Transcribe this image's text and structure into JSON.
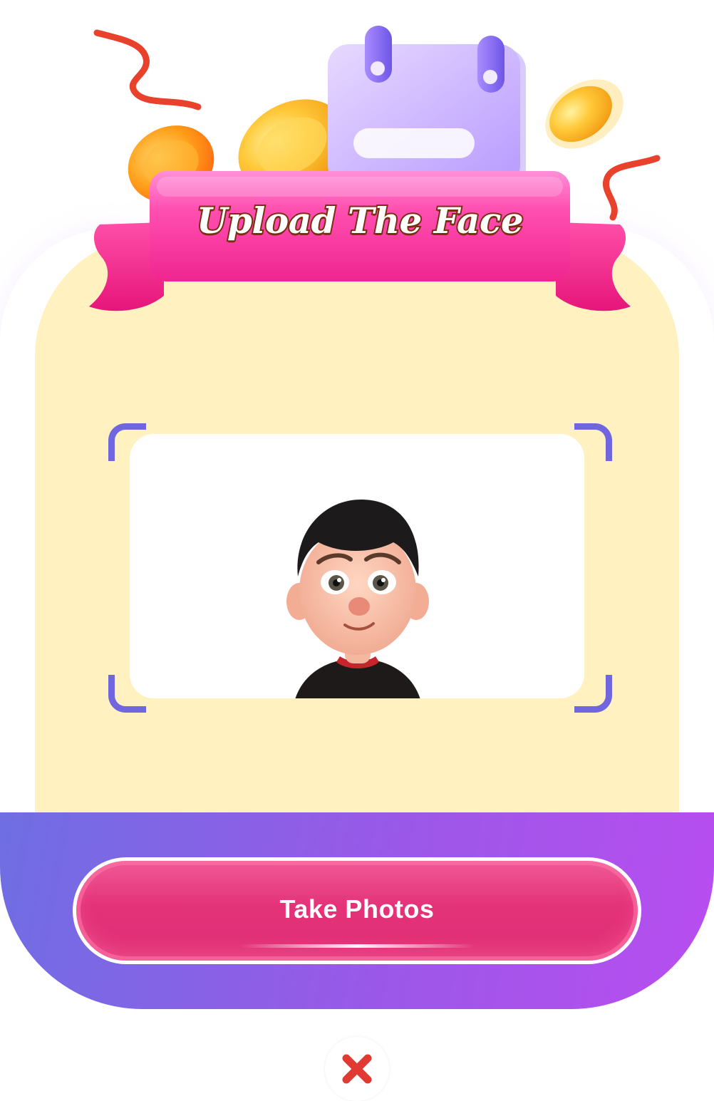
{
  "dialog": {
    "title": "Upload The Face",
    "primary_button_label": "Take Photos",
    "close_icon": "close-x-icon"
  },
  "colors": {
    "card_background": "#fff1c0",
    "banner_pink": "#ff4fb0",
    "title_outline": "#7a2d10",
    "frame_corner": "#6f66e0",
    "footer_gradient_start": "#6f6ee3",
    "footer_gradient_end": "#b94df0",
    "button_pink": "#e43279",
    "close_red": "#e03a32"
  },
  "icons": [
    "ribbon-streamer-icon",
    "coin-icon",
    "calendar-icon",
    "scan-frame-corners",
    "avatar-illustration",
    "close-x-icon"
  ]
}
